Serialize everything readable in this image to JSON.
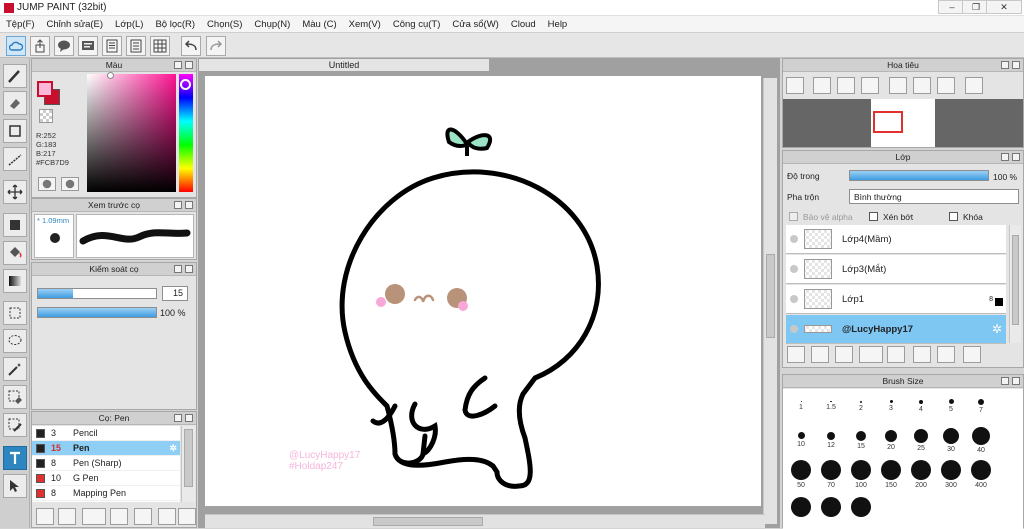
{
  "app": {
    "title": "JUMP PAINT (32bit)"
  },
  "menu": [
    "Tệp(F)",
    "Chỉnh sửa(E)",
    "Lớp(L)",
    "Bộ lọc(R)",
    "Chọn(S)",
    "Chụp(N)",
    "Màu (C)",
    "Xem(V)",
    "Công cụ(T)",
    "Cửa sổ(W)",
    "Cloud",
    "Help"
  ],
  "panels": {
    "color": {
      "title": "Màu",
      "r": "R:252",
      "g": "G:183",
      "b": "B:217",
      "hex": "#FCB7D9",
      "primary": "#fcb7d9",
      "secondary": "#c8102e"
    },
    "preview": {
      "title": "Xem trước cọ",
      "size": "* 1.09mm"
    },
    "brush_control": {
      "title": "Kiểm soát cọ",
      "size_value": "15",
      "opacity_value": "100 %",
      "size_fraction": 0.3,
      "opacity_fraction": 1.0
    },
    "pen": {
      "title": "Cọ: Pen",
      "items": [
        {
          "size": "3",
          "name": "Pencil",
          "color": "#222222"
        },
        {
          "size": "15",
          "name": "Pen",
          "color": "#222222"
        },
        {
          "size": "8",
          "name": "Pen (Sharp)",
          "color": "#222222"
        },
        {
          "size": "10",
          "name": "G Pen",
          "color": "#e03030"
        },
        {
          "size": "8",
          "name": "Mapping Pen",
          "color": "#e03030"
        }
      ]
    },
    "navigator": {
      "title": "Hoa tiêu"
    },
    "layers": {
      "title": "Lớp",
      "opacity_label": "Độ trong",
      "opacity_value": "100 %",
      "blend_label": "Pha trộn",
      "blend_value": "Bình thường",
      "protect_alpha": "Bảo vệ alpha",
      "clip": "Xén bớt",
      "lock": "Khóa",
      "items": [
        {
          "name": "Lớp4(Mầm)"
        },
        {
          "name": "Lớp3(Mắt)"
        },
        {
          "name": "Lớp1",
          "badge": "8"
        },
        {
          "name": "@LucyHappy17"
        }
      ]
    },
    "brush_size": {
      "title": "Brush Size",
      "sizes": [
        "1",
        "1.5",
        "2",
        "3",
        "4",
        "5",
        "7",
        "10",
        "12",
        "15",
        "20",
        "25",
        "30",
        "40",
        "50",
        "70",
        "100",
        "150",
        "200",
        "300",
        "400",
        "",
        "",
        ""
      ]
    }
  },
  "canvas": {
    "tab": "Untitled",
    "watermark_1": "@LucyHappy17",
    "watermark_2": "#Holdap247"
  },
  "colors": {
    "accent": "#2e86c1",
    "selected": "#8fcff6",
    "watermark": "#f6b5dc",
    "sprout": "#9be3c4",
    "cheek": "#f7a8d8",
    "eye": "#b9927a"
  }
}
